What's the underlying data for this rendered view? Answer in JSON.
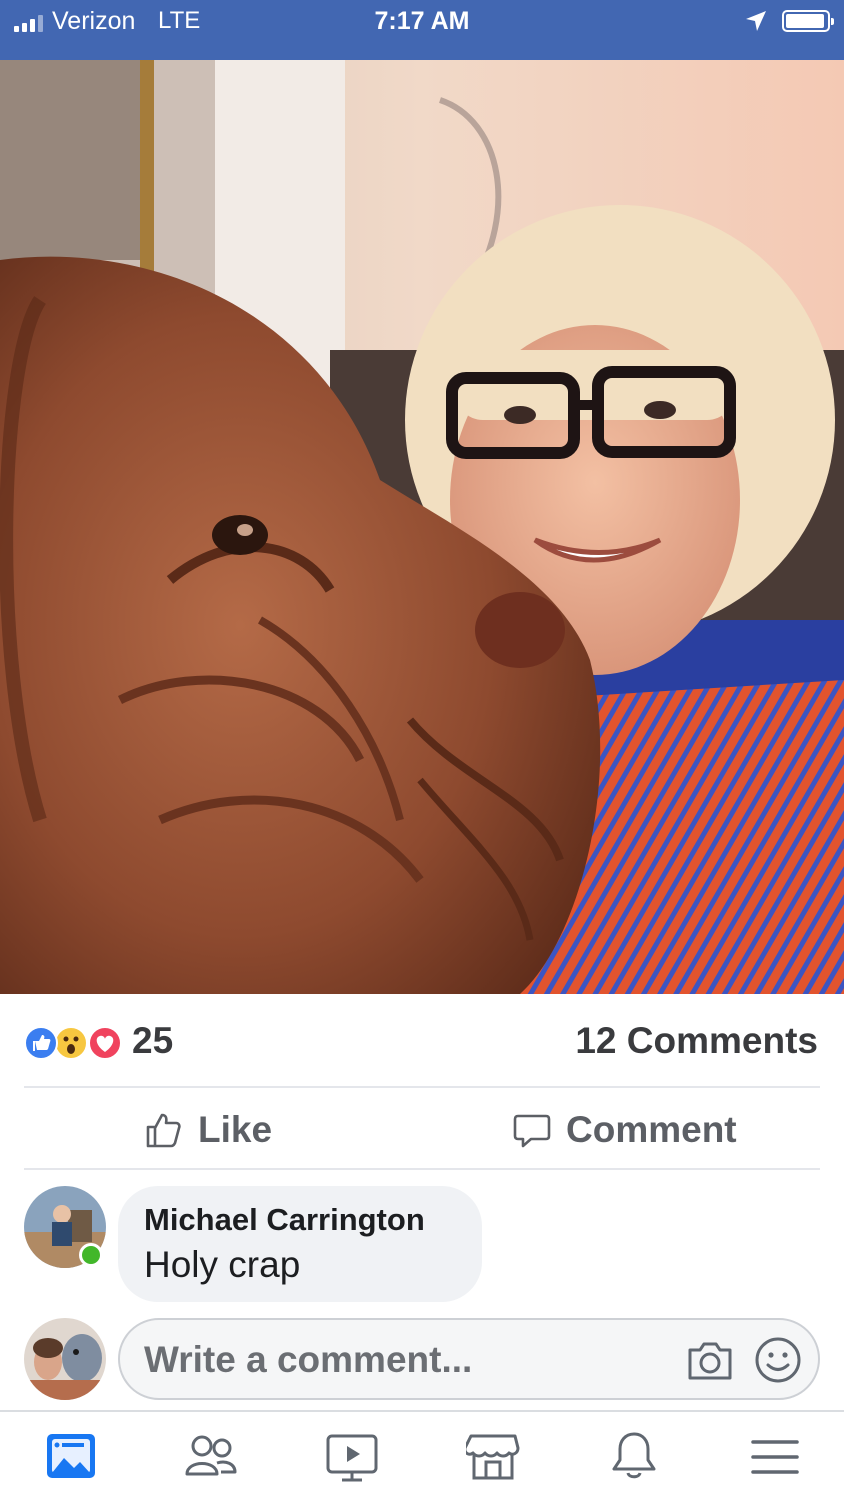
{
  "status_bar": {
    "carrier": "Verizon",
    "network": "LTE",
    "time": "7:17 AM",
    "battery_level": 0.95
  },
  "post": {
    "reaction_count": "25",
    "reaction_icons": [
      "like-reaction",
      "wow-reaction",
      "love-reaction"
    ],
    "comments_count": "12 Comments",
    "actions": {
      "like_label": "Like",
      "comment_label": "Comment"
    }
  },
  "comments": [
    {
      "author": "Michael Carrington",
      "text": "Holy crap",
      "online": true
    }
  ],
  "composer": {
    "placeholder": "Write a comment..."
  },
  "tab_bar": {
    "items": [
      "news-feed-icon",
      "friends-icon",
      "watch-icon",
      "marketplace-icon",
      "notifications-icon",
      "menu-icon"
    ],
    "active": 0
  },
  "colors": {
    "brand_blue": "#4267b2",
    "like_blue": "#3b7ef0",
    "love_red": "#f0435e",
    "wow_yellow": "#f7c740",
    "online_green": "#42b72a"
  }
}
